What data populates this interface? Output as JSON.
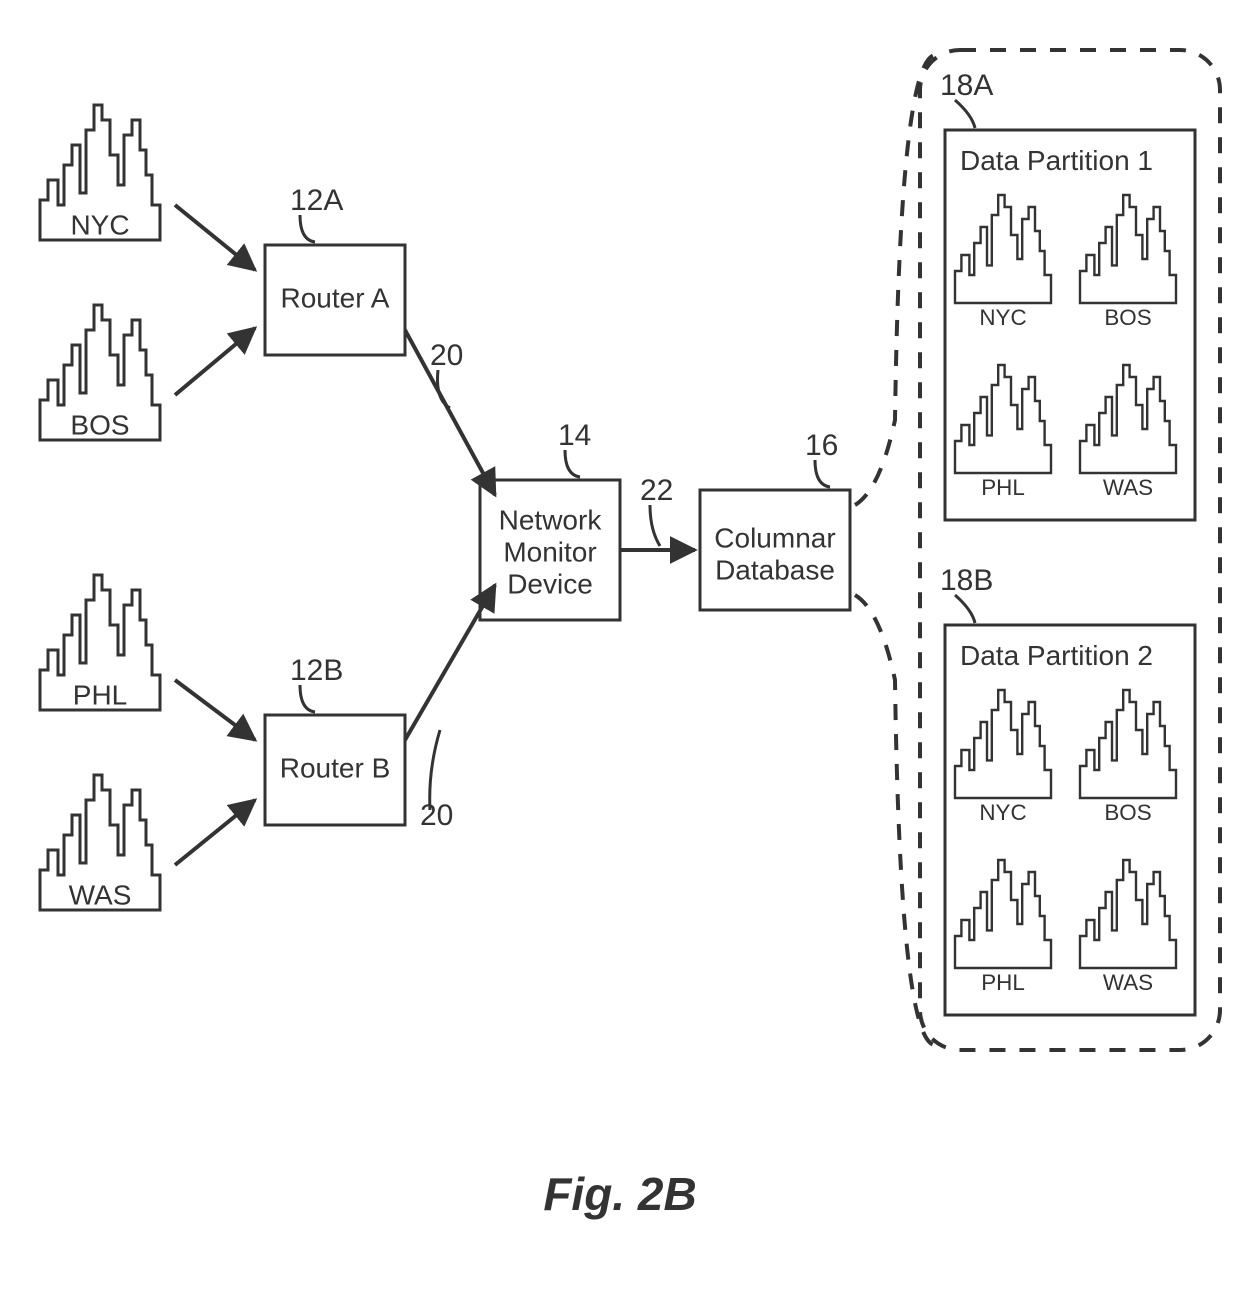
{
  "figure": {
    "caption": "Fig. 2B"
  },
  "cities": {
    "nyc": "NYC",
    "bos": "BOS",
    "phl": "PHL",
    "was": "WAS"
  },
  "routers": {
    "a": {
      "label": "Router A",
      "ref": "12A"
    },
    "b": {
      "label": "Router B",
      "ref": "12B"
    }
  },
  "monitor": {
    "label_l1": "Network",
    "label_l2": "Monitor",
    "label_l3": "Device",
    "ref": "14"
  },
  "edge_router_to_monitor_ref": "20",
  "edge_monitor_to_db_ref": "22",
  "database": {
    "label_l1": "Columnar",
    "label_l2": "Database",
    "ref": "16"
  },
  "partitions": {
    "p1": {
      "title": "Data Partition 1",
      "ref": "18A",
      "cities": [
        "NYC",
        "BOS",
        "PHL",
        "WAS"
      ]
    },
    "p2": {
      "title": "Data Partition 2",
      "ref": "18B",
      "cities": [
        "NYC",
        "BOS",
        "PHL",
        "WAS"
      ]
    }
  }
}
